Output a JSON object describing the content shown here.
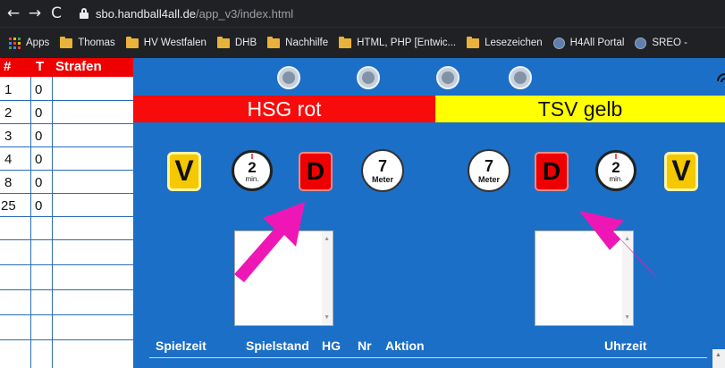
{
  "browser": {
    "back_glyph": "←",
    "forward_glyph": "→",
    "reload_glyph": "C",
    "url_host": "sbo.handball4all.de",
    "url_path": "/app_v3/index.html"
  },
  "bookmarks": [
    {
      "label": "Apps",
      "icon": "apps-grid-icon"
    },
    {
      "label": "Thomas",
      "icon": "folder-icon"
    },
    {
      "label": "HV Westfalen",
      "icon": "folder-icon"
    },
    {
      "label": "DHB",
      "icon": "folder-icon"
    },
    {
      "label": "Nachhilfe",
      "icon": "folder-icon"
    },
    {
      "label": "HTML, PHP [Entwic...",
      "icon": "folder-icon"
    },
    {
      "label": "Lesezeichen",
      "icon": "folder-icon"
    },
    {
      "label": "H4All Portal",
      "icon": "globe-icon"
    },
    {
      "label": "SREO -",
      "icon": "globe-icon"
    }
  ],
  "penalty_table": {
    "headers": {
      "number": "#",
      "t": "T",
      "penalties": "Strafen"
    },
    "rows": [
      {
        "number": "1",
        "t": "0"
      },
      {
        "number": "2",
        "t": "0"
      },
      {
        "number": "3",
        "t": "0"
      },
      {
        "number": "4",
        "t": "0"
      },
      {
        "number": "8",
        "t": "0"
      },
      {
        "number": "25",
        "t": "0"
      }
    ]
  },
  "toolbar_icons": [
    "grid-icon",
    "pencil-icon",
    "list-icon",
    "settings-icon"
  ],
  "teams": {
    "home": "HSG rot",
    "guest": "TSV gelb"
  },
  "actions": {
    "warning": "V",
    "disqualification": "D",
    "suspension_number": "2",
    "suspension_unit": "min.",
    "penalty_throw_number": "7",
    "penalty_throw_unit": "Meter"
  },
  "log": {
    "headers": [
      "Spielzeit",
      "Spielstand",
      "HG",
      "Nr",
      "Aktion",
      "Uhrzeit"
    ]
  },
  "colors": {
    "panel_blue": "#1c6fc7",
    "home_red": "#f80b0b",
    "guest_yellow": "#ffff00",
    "arrow_magenta": "#ee17b6"
  }
}
